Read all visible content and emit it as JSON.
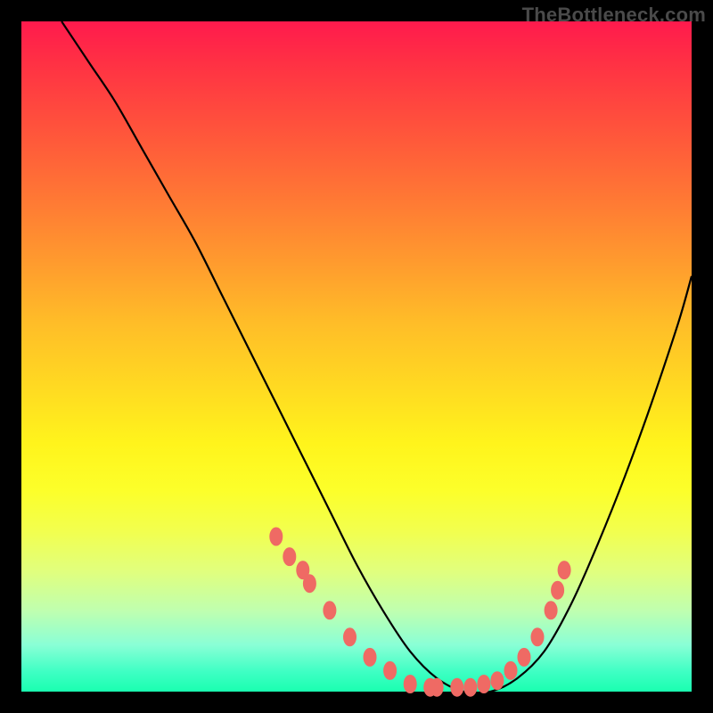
{
  "watermark": "TheBottleneck.com",
  "chart_data": {
    "type": "line",
    "title": "",
    "xlabel": "",
    "ylabel": "",
    "xlim": [
      0,
      100
    ],
    "ylim": [
      0,
      100
    ],
    "series": [
      {
        "name": "bottleneck-curve",
        "x": [
          6,
          10,
          14,
          18,
          22,
          26,
          30,
          34,
          38,
          42,
          46,
          50,
          54,
          58,
          62,
          66,
          70,
          74,
          78,
          82,
          86,
          90,
          94,
          98,
          100
        ],
        "y": [
          100,
          94,
          88,
          81,
          74,
          67,
          59,
          51,
          43,
          35,
          27,
          19,
          12,
          6,
          2,
          0,
          0,
          2,
          6,
          13,
          22,
          32,
          43,
          55,
          62
        ]
      }
    ],
    "markers": {
      "name": "highlight-dots",
      "x": [
        38,
        40,
        42,
        43,
        46,
        49,
        52,
        55,
        58,
        61,
        62,
        65,
        67,
        69,
        71,
        73,
        75,
        77,
        79,
        80,
        81
      ],
      "y": [
        23,
        20,
        18,
        16,
        12,
        8,
        5,
        3,
        1,
        0.5,
        0.5,
        0.5,
        0.5,
        1,
        1.5,
        3,
        5,
        8,
        12,
        15,
        18
      ]
    }
  }
}
